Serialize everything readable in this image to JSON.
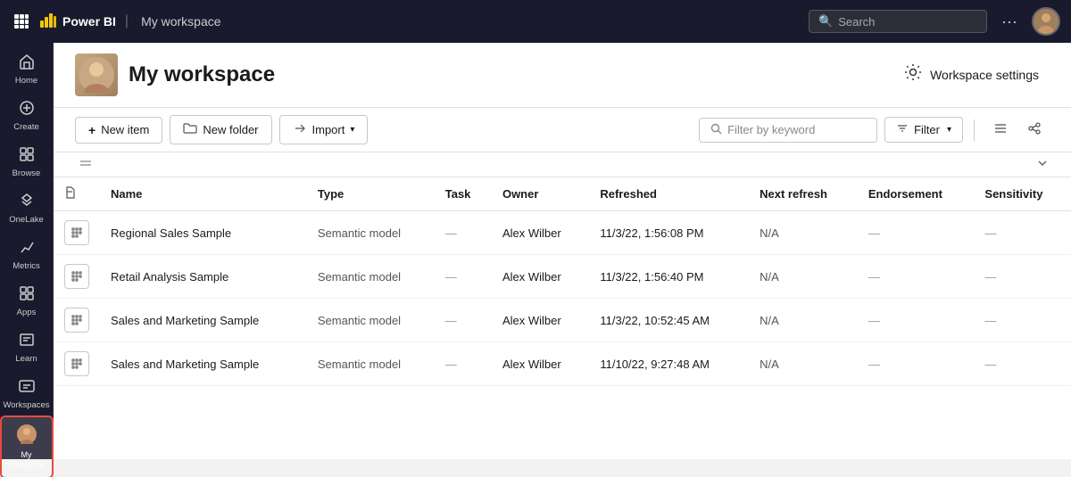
{
  "topbar": {
    "brand_logo": "⬛",
    "brand_name": "Power BI",
    "workspace_name": "My workspace",
    "search_placeholder": "Search",
    "more_label": "···"
  },
  "sidebar": {
    "items": [
      {
        "id": "home",
        "label": "Home",
        "icon": "🏠"
      },
      {
        "id": "create",
        "label": "Create",
        "icon": "➕"
      },
      {
        "id": "browse",
        "label": "Browse",
        "icon": "⊞"
      },
      {
        "id": "onelake",
        "label": "OneLake",
        "icon": "🔵"
      },
      {
        "id": "metrics",
        "label": "Metrics",
        "icon": "🏆"
      },
      {
        "id": "apps",
        "label": "Apps",
        "icon": "⊟"
      },
      {
        "id": "learn",
        "label": "Learn",
        "icon": "📖"
      },
      {
        "id": "workspaces",
        "label": "Workspaces",
        "icon": "⊞"
      },
      {
        "id": "myworkspace",
        "label": "My workspace",
        "icon": "👤",
        "active": true,
        "selected": true
      }
    ]
  },
  "header": {
    "title": "My workspace",
    "settings_label": "Workspace settings"
  },
  "toolbar": {
    "new_item_label": "New item",
    "new_folder_label": "New folder",
    "import_label": "Import",
    "filter_placeholder": "Filter by keyword",
    "filter_label": "Filter"
  },
  "table": {
    "columns": [
      "",
      "Name",
      "Type",
      "Task",
      "Owner",
      "Refreshed",
      "Next refresh",
      "Endorsement",
      "Sensitivity"
    ],
    "rows": [
      {
        "name": "Regional Sales Sample",
        "type": "Semantic model",
        "task": "—",
        "owner": "Alex Wilber",
        "refreshed": "11/3/22, 1:56:08 PM",
        "next_refresh": "N/A",
        "endorsement": "—",
        "sensitivity": "—"
      },
      {
        "name": "Retail Analysis Sample",
        "type": "Semantic model",
        "task": "—",
        "owner": "Alex Wilber",
        "refreshed": "11/3/22, 1:56:40 PM",
        "next_refresh": "N/A",
        "endorsement": "—",
        "sensitivity": "—"
      },
      {
        "name": "Sales and Marketing Sample",
        "type": "Semantic model",
        "task": "—",
        "owner": "Alex Wilber",
        "refreshed": "11/3/22, 10:52:45 AM",
        "next_refresh": "N/A",
        "endorsement": "—",
        "sensitivity": "—"
      },
      {
        "name": "Sales and Marketing Sample",
        "type": "Semantic model",
        "task": "—",
        "owner": "Alex Wilber",
        "refreshed": "11/10/22, 9:27:48 AM",
        "next_refresh": "N/A",
        "endorsement": "—",
        "sensitivity": "—"
      }
    ]
  }
}
